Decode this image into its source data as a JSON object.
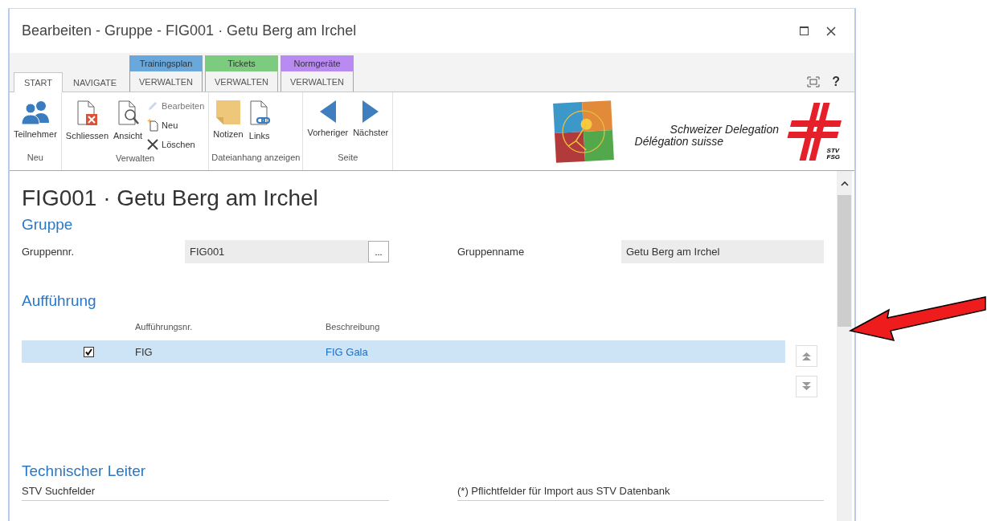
{
  "window": {
    "title": "Bearbeiten - Gruppe - FIG001 · Getu Berg am Irchel"
  },
  "ribbon": {
    "tabs": [
      {
        "label": "START",
        "selected": true
      },
      {
        "label": "NAVIGATE",
        "selected": false
      },
      {
        "group": "Trainingsplan",
        "label": "VERWALTEN",
        "selected": false,
        "color": "#6aa7da"
      },
      {
        "group": "Tickets",
        "label": "VERWALTEN",
        "selected": false,
        "color": "#7ccb7e"
      },
      {
        "group": "Normgeräte",
        "label": "VERWALTEN",
        "selected": false,
        "color": "#b98af2"
      }
    ],
    "help": "?",
    "groups": [
      {
        "label": "Neu",
        "buttons": [
          {
            "kind": "people",
            "label": "Teilnehmer"
          }
        ]
      },
      {
        "label": "Verwalten",
        "buttons": [
          {
            "kind": "close-doc",
            "label": "Schliessen"
          },
          {
            "kind": "view-doc",
            "label": "Ansicht"
          }
        ],
        "small": [
          {
            "kind": "edit",
            "label": "Bearbeiten",
            "disabled": true
          },
          {
            "kind": "new",
            "label": "Neu",
            "disabled": false
          },
          {
            "kind": "delete",
            "label": "Löschen",
            "disabled": false
          }
        ]
      },
      {
        "label": "Dateianhang anzeigen",
        "buttons": [
          {
            "kind": "note",
            "label": "Notizen"
          },
          {
            "kind": "link-doc",
            "label": "Links"
          }
        ]
      },
      {
        "label": "Seite",
        "buttons": [
          {
            "kind": "prev",
            "label": "Vorheriger"
          },
          {
            "kind": "next",
            "label": "Nächster"
          }
        ]
      }
    ],
    "banner": {
      "line1": "Schweizer Delegation",
      "line2": "Délégation suisse",
      "logo_lines": [
        "STV",
        "FSG"
      ]
    }
  },
  "page": {
    "title": "FIG001 · Getu Berg am Irchel",
    "gruppe": {
      "heading": "Gruppe",
      "fields": [
        {
          "label": "Gruppennr.",
          "value": "FIG001",
          "lookup": "..."
        },
        {
          "label": "Gruppenname",
          "value": "Getu Berg am Irchel"
        }
      ]
    },
    "auffuehrung": {
      "heading": "Aufführung",
      "columns": [
        "Aufführungsnr.",
        "Beschreibung"
      ],
      "rows": [
        {
          "checked": true,
          "selected": true,
          "nr": "FIG",
          "beschreibung": "FIG Gala"
        }
      ]
    },
    "leiter": {
      "heading": "Technischer Leiter",
      "labels": [
        "STV Suchfelder",
        "(*) Pflichtfelder für Import aus STV Datenbank"
      ]
    }
  }
}
